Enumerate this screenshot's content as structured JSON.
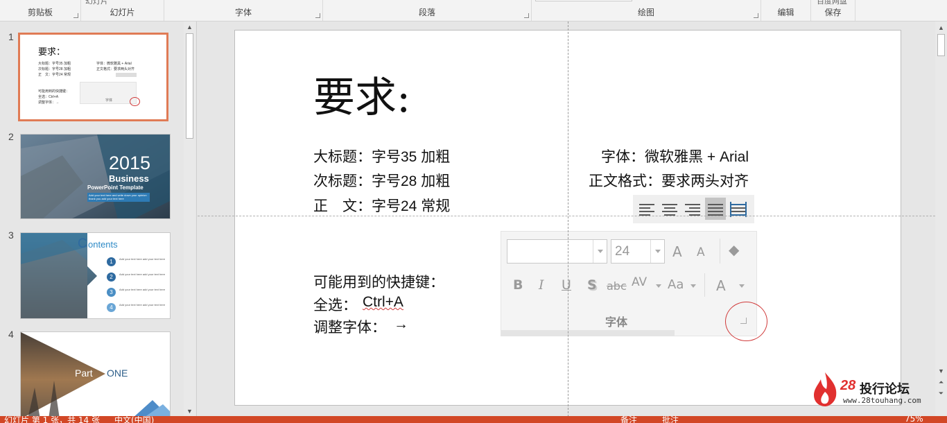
{
  "ribbon": {
    "groups": [
      {
        "label": "剪贴板"
      },
      {
        "label": "幻灯片"
      },
      {
        "label": "字体"
      },
      {
        "label": "段落"
      },
      {
        "label": "绘图"
      },
      {
        "label": "编辑"
      },
      {
        "label": "保存"
      }
    ],
    "peek_new_slide": "幻灯片",
    "peek_save": "百度网盘"
  },
  "thumbnails": [
    {
      "number": "1",
      "selected": true
    },
    {
      "number": "2",
      "year": "2015",
      "title": "Business",
      "subtitle": "PowerPoint Template",
      "blurb": "Add your text here and write down your opinion thank you add your text here"
    },
    {
      "number": "3",
      "title": "Contents",
      "items": [
        "Add your text here add your text here",
        "Add your text here add your text here",
        "Add your text here add your text here",
        "Add your text here add your text here"
      ],
      "nums": [
        "1",
        "2",
        "3",
        "4"
      ]
    },
    {
      "number": "4",
      "part": "Part",
      "part_num": "ONE"
    }
  ],
  "slide": {
    "title": "要求:",
    "left_lines": [
      "大标题：字号35 加粗",
      "次标题：字号28 加粗",
      "正　文：字号24 常规"
    ],
    "right_lines": [
      "字体：微软雅黑 + Arial",
      "正文格式：要求两头对齐"
    ],
    "shortcuts_heading": "可能用到的快捷键：",
    "shortcut_select_all_label": "全选：",
    "shortcut_select_all_key": "Ctrl+A",
    "shortcut_adjust_label": "调整字体：",
    "shortcut_adjust_arrow": "→"
  },
  "font_panel": {
    "font_name": "",
    "font_size": "24",
    "grow": "A",
    "shrink": "A",
    "bold": "B",
    "italic": "I",
    "underline": "U",
    "shadow": "S",
    "strike": "abc",
    "spacing": "AV",
    "case": "Aa",
    "color": "A",
    "group_label": "字体"
  },
  "thumb1": {
    "title": "要求：",
    "l1": "大标题：字号35 加粗",
    "l2": "次标题：字号28 加粗",
    "l3": "正　文：字号24 常规",
    "r1": "字体：微软雅黑 + Arial",
    "r2": "正文格式：要求两头对齐",
    "s1": "可能用到的快捷键：",
    "s2": "全选：Ctrl+A",
    "s3": "调整字体：→",
    "label": "字体"
  },
  "watermark": {
    "num": "28",
    "name": "投行论坛",
    "url": "www.28touhang.com"
  },
  "status": {
    "slide_info": "幻灯片 第 1 张，共 14 张",
    "language": "中文(中国)",
    "notes": "备注",
    "comments": "批注",
    "zoom": "75%"
  },
  "colors": {
    "accent": "#d24726",
    "selection_border": "#e07b55",
    "annotation_circle": "#d03a3a"
  }
}
